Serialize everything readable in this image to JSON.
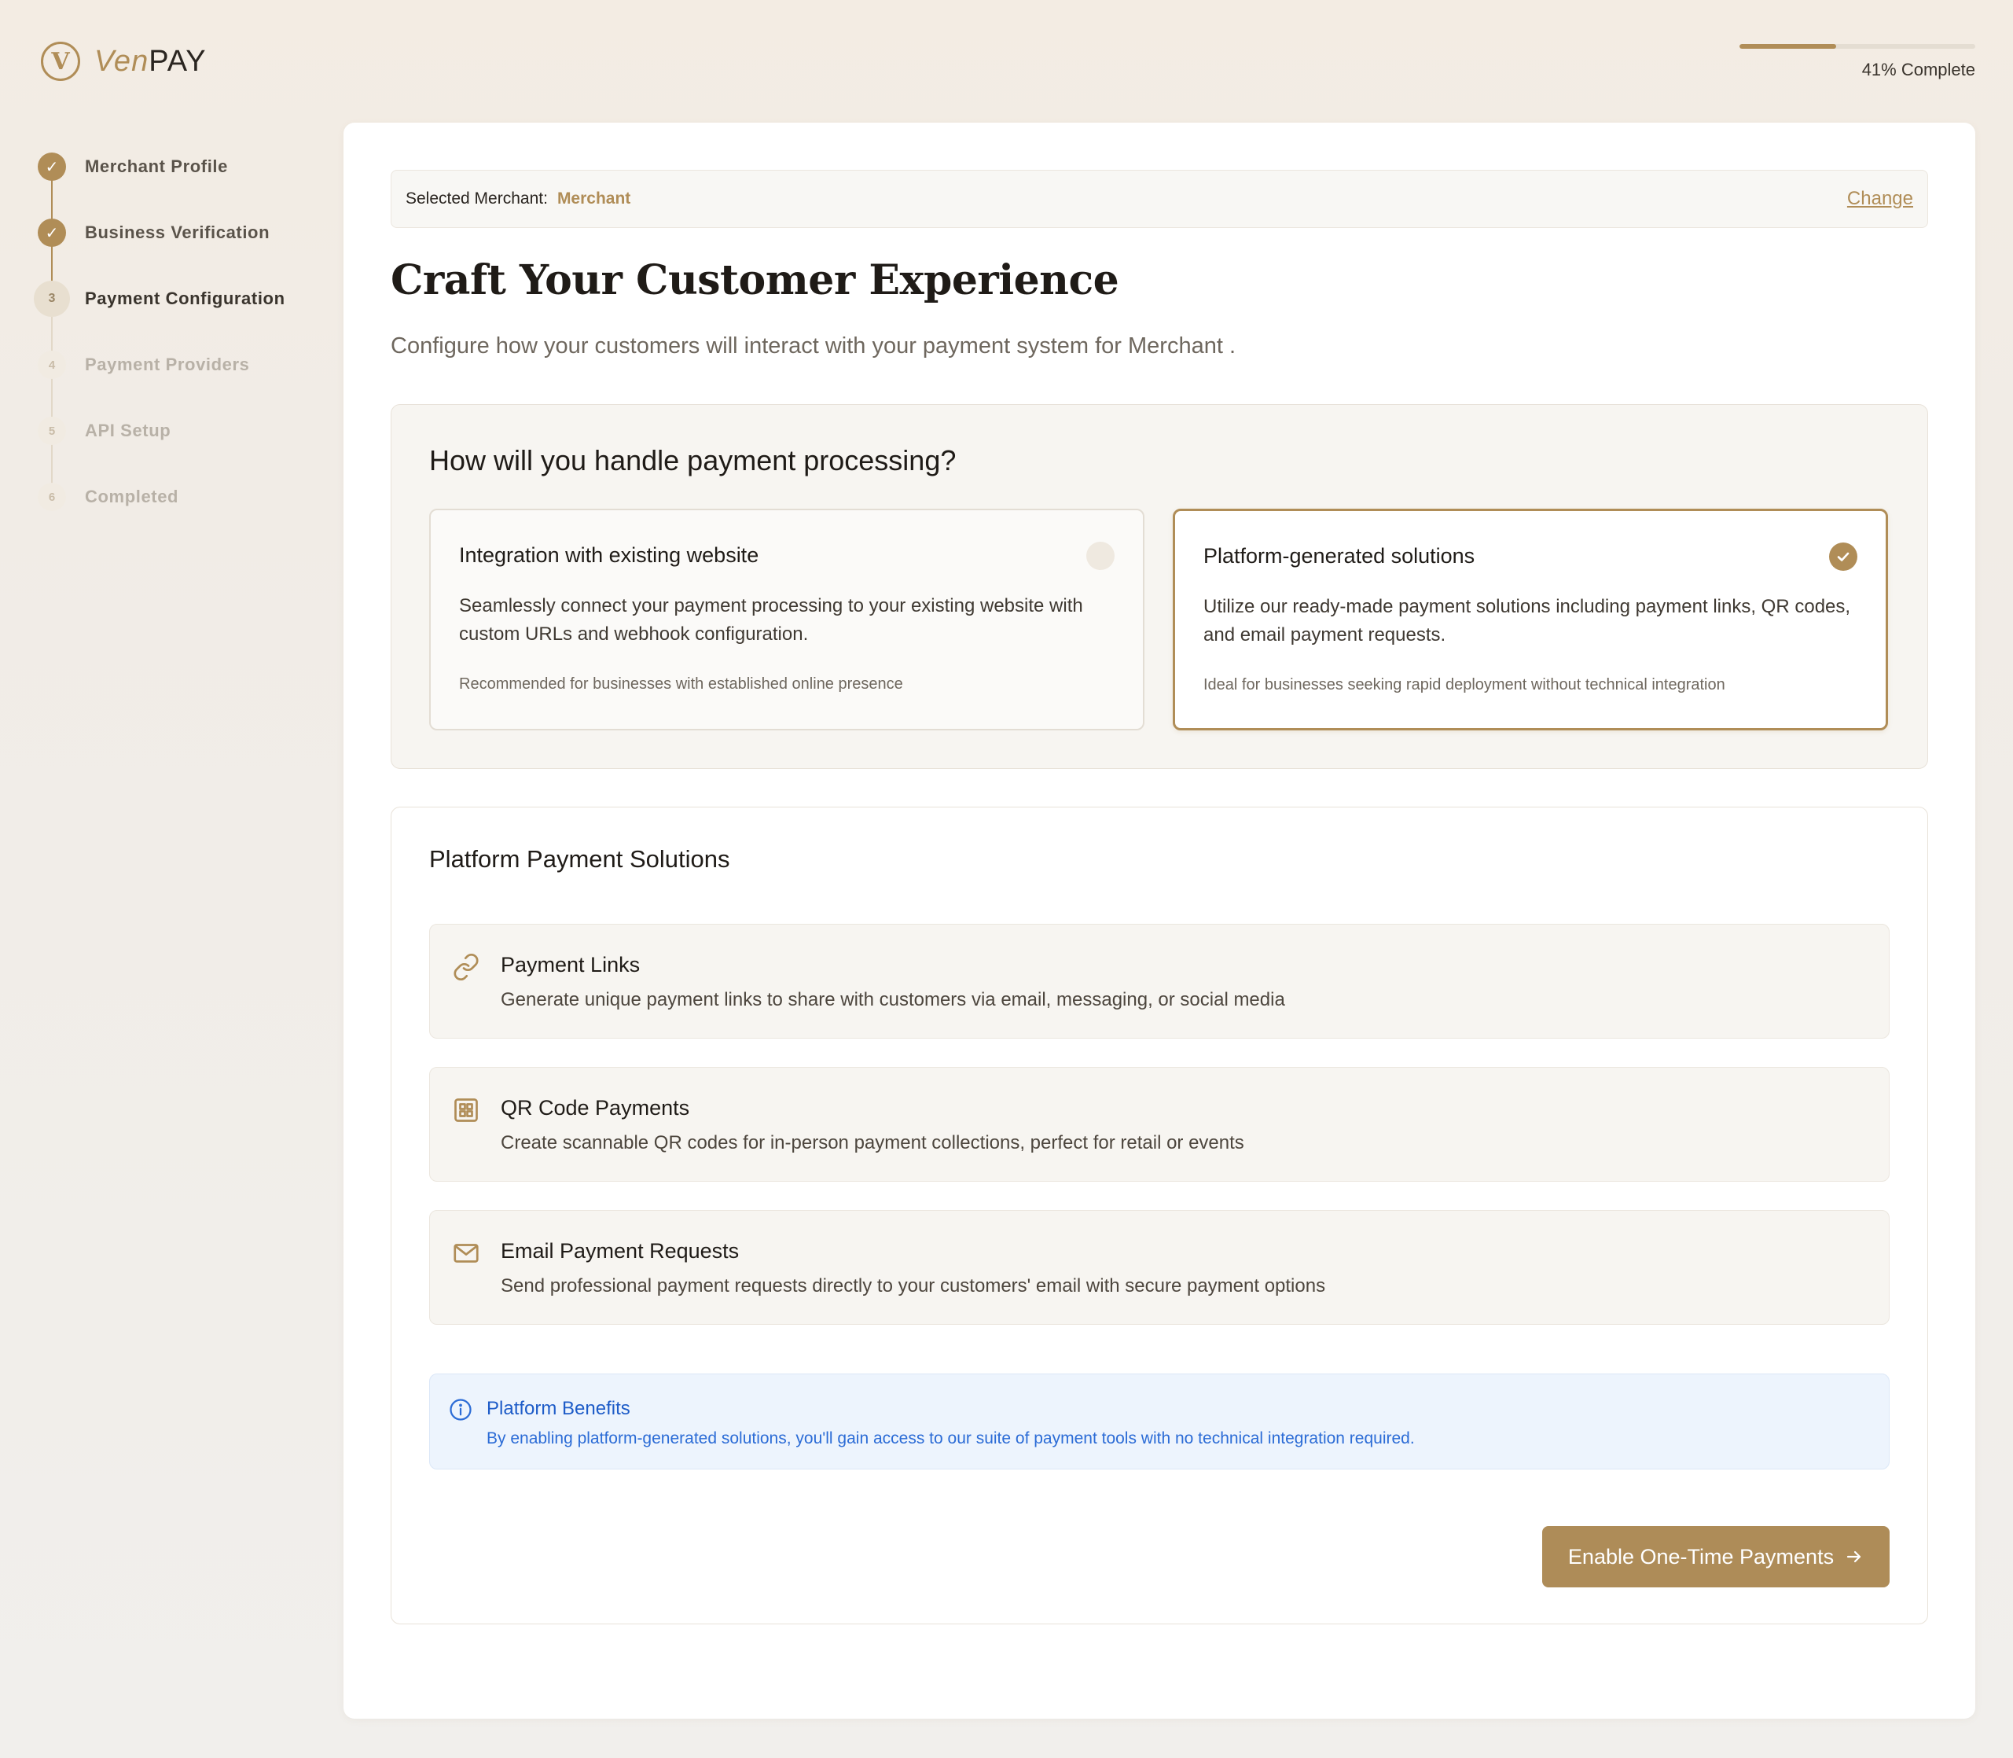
{
  "brand": {
    "prefix": "Ven",
    "suffix": "PAY",
    "accent": "#b08d57"
  },
  "progress": {
    "percent": 41,
    "label": "41% Complete"
  },
  "steps": [
    {
      "label": "Merchant Profile",
      "state": "done",
      "marker": "✓"
    },
    {
      "label": "Business Verification",
      "state": "done",
      "marker": "✓"
    },
    {
      "label": "Payment Configuration",
      "state": "active",
      "marker": "3"
    },
    {
      "label": "Payment Providers",
      "state": "pending",
      "marker": "4"
    },
    {
      "label": "API Setup",
      "state": "pending",
      "marker": "5"
    },
    {
      "label": "Completed",
      "state": "pending",
      "marker": "6"
    }
  ],
  "merchant_bar": {
    "label": "Selected Merchant:",
    "name": "Merchant",
    "change": "Change"
  },
  "page": {
    "title": "Craft Your Customer Experience",
    "subtitle": "Configure how your customers will interact with your payment system for Merchant ."
  },
  "processing": {
    "question": "How will you handle payment processing?",
    "options": [
      {
        "title": "Integration with existing website",
        "description": "Seamlessly connect your payment processing to your existing website with custom URLs and webhook configuration.",
        "note": "Recommended for businesses with established online presence",
        "selected": false
      },
      {
        "title": "Platform-generated solutions",
        "description": "Utilize our ready-made payment solutions including payment links, QR codes, and email payment requests.",
        "note": "Ideal for businesses seeking rapid deployment without technical integration",
        "selected": true
      }
    ]
  },
  "solutions": {
    "title": "Platform Payment Solutions",
    "items": [
      {
        "icon": "link-icon",
        "title": "Payment Links",
        "description": "Generate unique payment links to share with customers via email, messaging, or social media"
      },
      {
        "icon": "qr-code-icon",
        "title": "QR Code Payments",
        "description": "Create scannable QR codes for in-person payment collections, perfect for retail or events"
      },
      {
        "icon": "mail-icon",
        "title": "Email Payment Requests",
        "description": "Send professional payment requests directly to your customers' email with secure payment options"
      }
    ],
    "benefits": {
      "title": "Platform Benefits",
      "description": "By enabling platform-generated solutions, you'll gain access to our suite of payment tools with no technical integration required."
    },
    "cta": "Enable One-Time Payments"
  }
}
